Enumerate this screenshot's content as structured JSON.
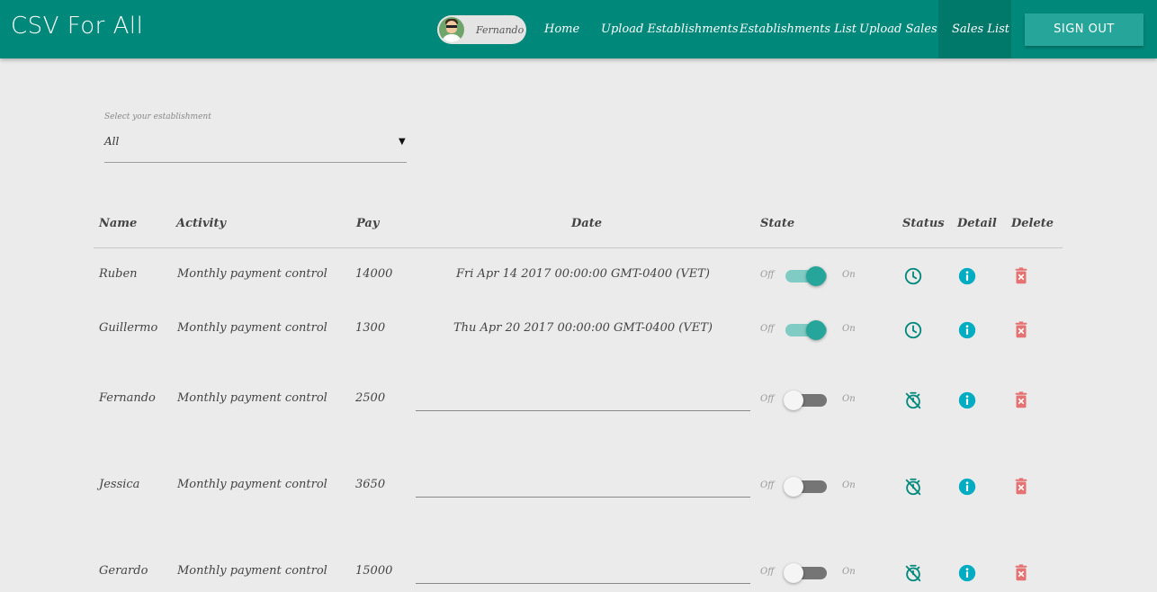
{
  "app": {
    "brand": "CSV For All"
  },
  "user": {
    "name": "Fernando"
  },
  "nav": {
    "home": "Home",
    "upload_establishments": "Upload Establishments",
    "establishments_list": "Establishments List",
    "upload_sales": "Upload Sales",
    "sales_list": "Sales List",
    "sign_out": "SIGN OUT"
  },
  "filter": {
    "label": "Select your establishment",
    "value": "All"
  },
  "table": {
    "headers": {
      "name": "Name",
      "activity": "Activity",
      "pay": "Pay",
      "date": "Date",
      "state": "State",
      "status": "Status",
      "detail": "Detail",
      "delete": "Delete"
    },
    "toggle_off_label": "Off",
    "toggle_on_label": "On",
    "rows": [
      {
        "name": "Ruben",
        "activity": "Monthly payment control",
        "pay": "14000",
        "date": "Fri Apr 14 2017 00:00:00 GMT-0400 (VET)",
        "state_on": true,
        "status_icon": "clock-icon"
      },
      {
        "name": "Guillermo",
        "activity": "Monthly payment control",
        "pay": "1300",
        "date": "Thu Apr 20 2017 00:00:00 GMT-0400 (VET)",
        "state_on": true,
        "status_icon": "clock-icon"
      },
      {
        "name": "Fernando",
        "activity": "Monthly payment control",
        "pay": "2500",
        "date": "",
        "state_on": false,
        "status_icon": "timer-off-icon"
      },
      {
        "name": "Jessica",
        "activity": "Monthly payment control",
        "pay": "3650",
        "date": "",
        "state_on": false,
        "status_icon": "timer-off-icon"
      },
      {
        "name": "Gerardo",
        "activity": "Monthly payment control",
        "pay": "15000",
        "date": "",
        "state_on": false,
        "status_icon": "timer-off-icon"
      }
    ]
  },
  "colors": {
    "primary": "#00897b",
    "accent": "#26a69a",
    "info": "#00acc1",
    "danger": "#e57373"
  }
}
